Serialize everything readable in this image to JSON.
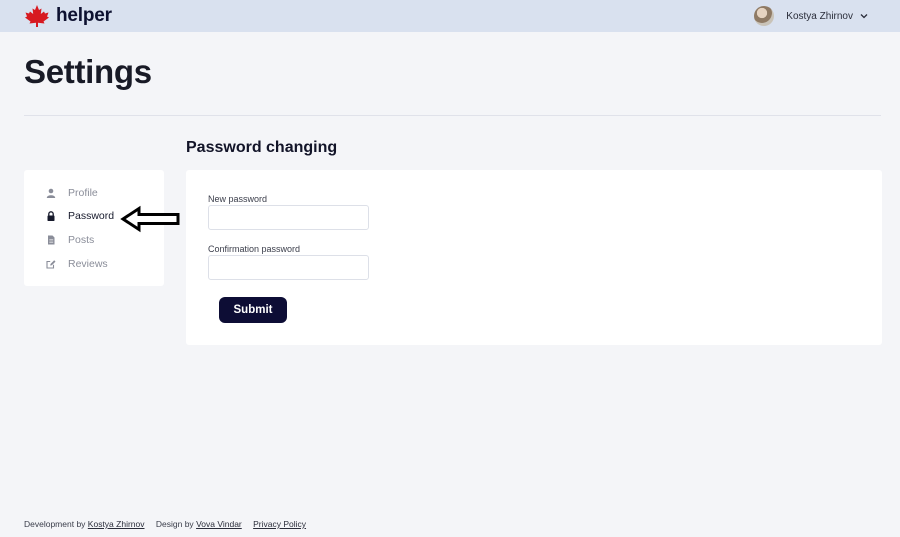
{
  "header": {
    "brand": "helper",
    "logo_icon": "maple-leaf-icon",
    "user_name": "Kostya Zhirnov",
    "brand_color": "#d71920"
  },
  "page": {
    "title": "Settings"
  },
  "sidebar": {
    "items": [
      {
        "label": "Profile",
        "icon": "user-icon",
        "active": false
      },
      {
        "label": "Password",
        "icon": "lock-icon",
        "active": true
      },
      {
        "label": "Posts",
        "icon": "document-icon",
        "active": false
      },
      {
        "label": "Reviews",
        "icon": "edit-icon",
        "active": false
      }
    ]
  },
  "form": {
    "title": "Password changing",
    "new_password_label": "New password",
    "new_password_value": "",
    "confirm_password_label": "Confirmation password",
    "confirm_password_value": "",
    "submit_label": "Submit"
  },
  "footer": {
    "dev_prefix": "Development by",
    "dev_name": "Kostya Zhirnov",
    "design_prefix": "Design by",
    "design_name": "Vova Vindar",
    "privacy": "Privacy Policy"
  }
}
